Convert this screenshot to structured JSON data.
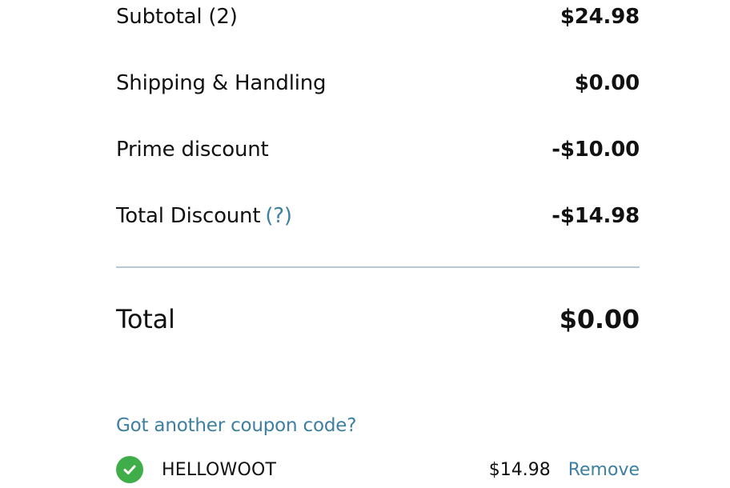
{
  "summary": {
    "subtotal_label": "Subtotal (2)",
    "subtotal_value": "$24.98",
    "shipping_label": "Shipping & Handling",
    "shipping_value": "$0.00",
    "prime_label": "Prime discount",
    "prime_value": "-$10.00",
    "total_discount_label": "Total Discount",
    "total_discount_help": "(?)",
    "total_discount_value": "-$14.98",
    "total_label": "Total",
    "total_value": "$0.00"
  },
  "coupon": {
    "prompt_link": "Got another coupon code?",
    "applied_code": "HELLOWOOT",
    "applied_amount": "$14.98",
    "remove_label": "Remove",
    "status_icon": "check-circle-icon"
  },
  "colors": {
    "link": "#3d7fa0",
    "success": "#3fae49",
    "divider": "#b8c9d3"
  }
}
